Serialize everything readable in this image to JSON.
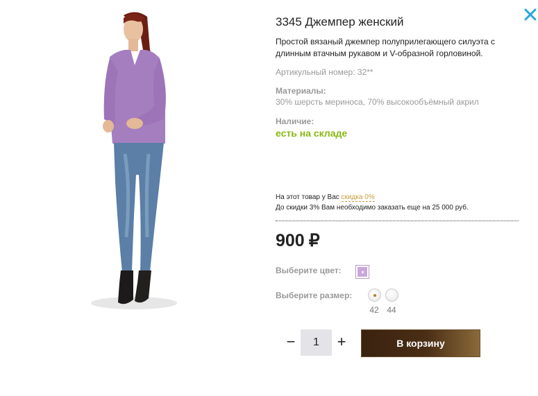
{
  "product": {
    "title": "3345 Джемпер женский",
    "description": "Простой вязаный джемпер полуприлегающего силуэта с длинным втачным рукавом и V-образной горловиной.",
    "article": "Артикульный номер: 32**",
    "materials_label": "Материалы:",
    "materials_value": "30% шерсть мериноса, 70% высокообъёмный акрил",
    "availability_label": "Наличие:",
    "availability_value": "есть на складе"
  },
  "discount": {
    "line1_prefix": "На этот товар у Вас ",
    "link": "скидка 0%",
    "line2": "До скидки 3% Вам необходимо заказать еще на 25 000 руб."
  },
  "price": {
    "amount": "900",
    "currency": "₽"
  },
  "color": {
    "label": "Выберите цвет:",
    "selected_hex": "#c9a7dc"
  },
  "size": {
    "label": "Выберите размер:",
    "options": [
      "42",
      "44"
    ],
    "selected": "42"
  },
  "quantity": {
    "minus": "−",
    "value": "1",
    "plus": "+"
  },
  "cart_button": "В корзину",
  "colors": {
    "accent_green": "#88b813",
    "cart_button": "#4a2e15",
    "close": "#2aa6e0",
    "discount_link": "#c99a3a"
  },
  "icons": {
    "close": "close-icon"
  }
}
